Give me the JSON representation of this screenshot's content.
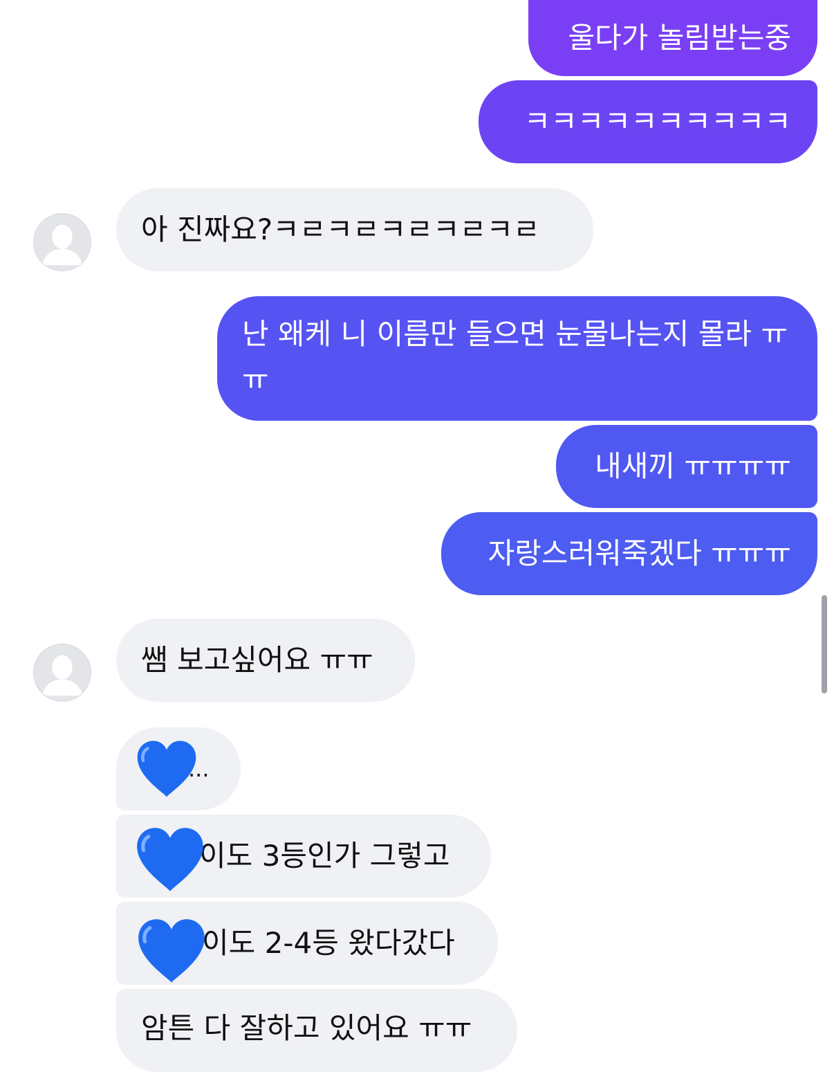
{
  "colors": {
    "outgoing_top": "#7a3ff5",
    "outgoing_bottom": "#4f5cf0",
    "incoming_bg": "#f0f1f4",
    "heart": "#1e6bf2"
  },
  "messages": [
    {
      "from": "me",
      "text": "울다가 놀림받는중"
    },
    {
      "from": "me",
      "text": "ㅋㅋㅋㅋㅋㅋㅋㅋㅋㅋ"
    },
    {
      "from": "other",
      "text": "아 진짜요?ㅋㄹㅋㄹㅋㄹㅋㄹㅋㄹ"
    },
    {
      "from": "me",
      "text": "난 왜케 니 이름만 들으면 눈물나는지 몰라 ㅠㅠ"
    },
    {
      "from": "me",
      "text": "내새끼 ㅠㅠㅠㅠ"
    },
    {
      "from": "me",
      "text": "자랑스러워죽겠다 ㅠㅠㅠ"
    },
    {
      "from": "other",
      "text": "쌤 보고싶어요 ㅠㅠ"
    },
    {
      "from": "other",
      "text": "..."
    },
    {
      "from": "other",
      "text": "이도 3등인가 그렇고"
    },
    {
      "from": "other",
      "text": "이도 2-4등 왔다갔다"
    },
    {
      "from": "other",
      "text": "암튼 다 잘하고 있어요 ㅠㅠ"
    }
  ],
  "icons": {
    "avatar": "default-person-avatar",
    "heart": "blue-heart-emoji"
  }
}
